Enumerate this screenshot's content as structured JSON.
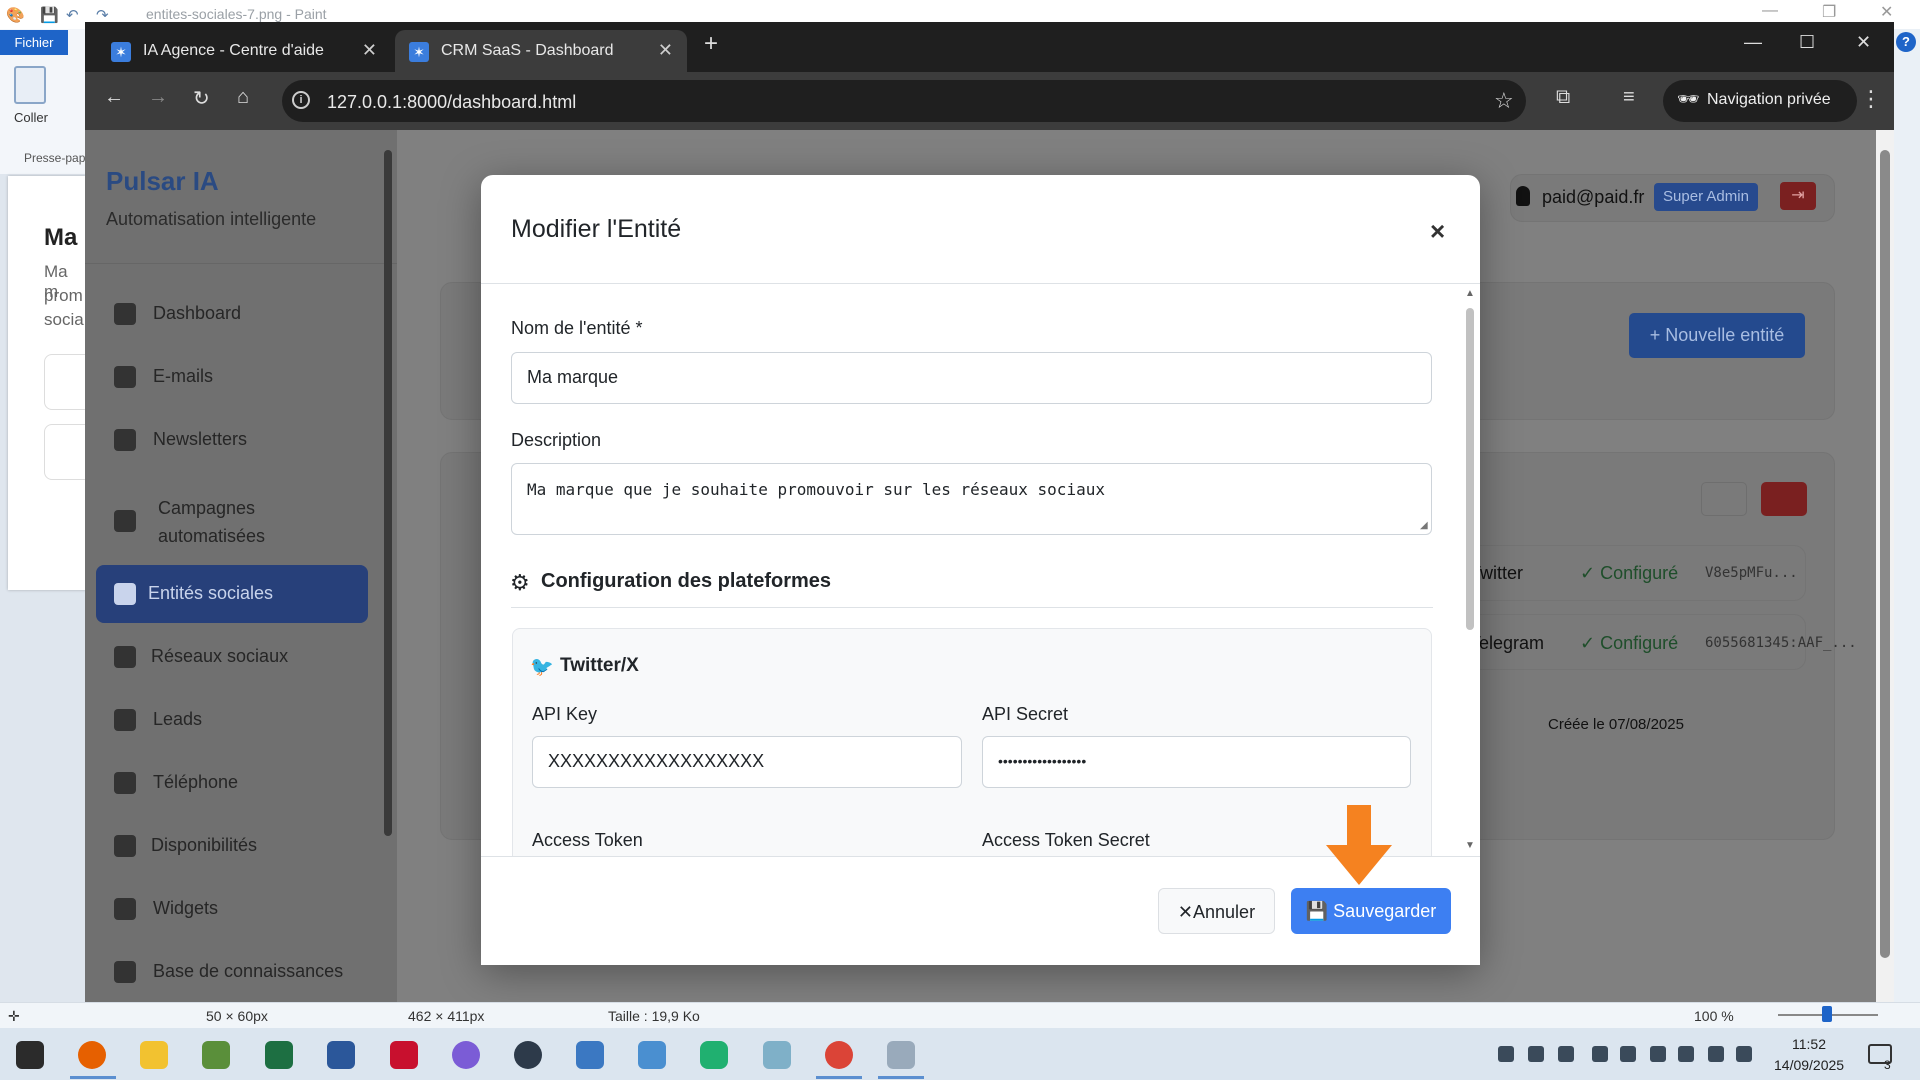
{
  "paint": {
    "title": "entites-sociales-7.png - Paint",
    "fichier_tab": "Fichier",
    "coller_label": "Coller",
    "presse_label": "Presse-pap",
    "canvas_heading": "Ma",
    "canvas_lines": [
      "Ma m",
      "prom",
      "socia"
    ],
    "status_selection": "50 × 60px",
    "status_dimensions": "462 × 411px",
    "status_size": "Taille : 19,9 Ko",
    "zoom": "100 %"
  },
  "browser": {
    "tabs": [
      {
        "label": "IA Agence - Centre d'aide",
        "active": false
      },
      {
        "label": "CRM SaaS - Dashboard",
        "active": true
      }
    ],
    "url": "127.0.0.1:8000/dashboard.html",
    "private_label": "Navigation privée"
  },
  "app": {
    "brand_name": "Pulsar IA",
    "brand_tagline": "Automatisation intelligente",
    "sidebar_items": [
      {
        "label": "Dashboard",
        "icon": "dashboard-icon"
      },
      {
        "label": "E-mails",
        "icon": "envelope-icon"
      },
      {
        "label": "Newsletters",
        "icon": "newspaper-icon"
      },
      {
        "label": "Campagnes automatisées",
        "icon": "campaign-icon"
      },
      {
        "label": "Entités sociales",
        "icon": "building-icon",
        "active": true
      },
      {
        "label": "Réseaux sociaux",
        "icon": "share-icon"
      },
      {
        "label": "Leads",
        "icon": "target-icon"
      },
      {
        "label": "Téléphone",
        "icon": "phone-icon"
      },
      {
        "label": "Disponibilités",
        "icon": "calendar-icon"
      },
      {
        "label": "Widgets",
        "icon": "puzzle-icon"
      },
      {
        "label": "Base de connaissances",
        "icon": "brain-icon"
      }
    ],
    "user_email": "paid@paid.fr",
    "user_role": "Super Admin",
    "new_entity_button": "+ Nouvelle entité",
    "platform_rows": [
      {
        "platform": "Twitter",
        "status": "Configuré",
        "token": "V8e5pMFu..."
      },
      {
        "platform": "Telegram",
        "status": "Configuré",
        "token": "6055681345:AAF_..."
      }
    ],
    "created_label": "Créée le 07/08/2025"
  },
  "modal": {
    "title": "Modifier l'Entité",
    "name_label": "Nom de l'entité *",
    "name_value": "Ma marque",
    "description_label": "Description",
    "description_value": "Ma marque que je souhaite promouvoir sur les réseaux sociaux",
    "config_heading": "Configuration des plateformes",
    "twitter_title": "Twitter/X",
    "api_key_label": "API Key",
    "api_key_value": "XXXXXXXXXXXXXXXXXX",
    "api_secret_label": "API Secret",
    "api_secret_value": "••••••••••••••••••",
    "access_token_label": "Access Token",
    "access_token_secret_label": "Access Token Secret",
    "cancel_label": "Annuler",
    "save_label": "Sauvegarder"
  },
  "taskbar": {
    "time": "11:52",
    "date": "14/09/2025",
    "notification_count": "3"
  },
  "colors": {
    "primary": "#3d7ff2",
    "annotation_arrow": "#f58220",
    "sidebar_active": "#27407a",
    "success": "#1e4e2a"
  }
}
